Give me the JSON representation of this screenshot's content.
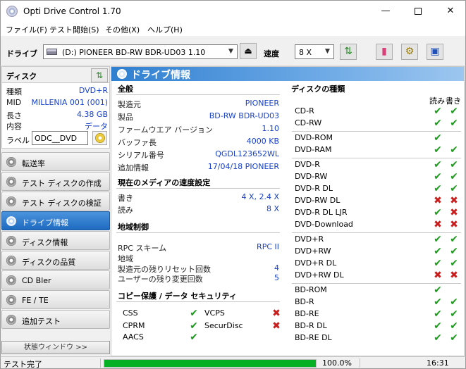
{
  "window": {
    "title": "Opti Drive Control 1.70"
  },
  "menu": [
    "ファイル(F)",
    "テスト開始(S)",
    "その他(X)",
    "ヘルプ(H)"
  ],
  "toolbar": {
    "drive_label": "ドライブ",
    "drive_value": "(D:)   PIONEER BD-RW   BDR-UD03 1.10",
    "speed_label": "速度",
    "speed_value": "8 X"
  },
  "disc": {
    "header": "ディスク",
    "fields": [
      {
        "key": "種類",
        "value": "DVD+R"
      },
      {
        "key": "MID",
        "value": "MILLENIA 001 (001)"
      },
      {
        "key": "長さ",
        "value": "4.38 GB"
      },
      {
        "key": "内容",
        "value": "データ"
      }
    ],
    "label_key": "ラベル",
    "label_value": "ODC__DVD"
  },
  "nav": [
    {
      "label": "転送率",
      "active": false
    },
    {
      "label": "テスト ディスクの作成",
      "active": false
    },
    {
      "label": "テスト ディスクの検証",
      "active": false
    },
    {
      "label": "ドライブ情報",
      "active": true
    },
    {
      "label": "ディスク情報",
      "active": false
    },
    {
      "label": "ディスクの品質",
      "active": false
    },
    {
      "label": "CD Bler",
      "active": false
    },
    {
      "label": "FE / TE",
      "active": false
    },
    {
      "label": "追加テスト",
      "active": false
    }
  ],
  "status_window_label": "状態ウィンドウ >>",
  "main": {
    "title": "ドライブ情報",
    "general": {
      "heading": "全般",
      "rows": [
        {
          "key": "製造元",
          "value": "PIONEER"
        },
        {
          "key": "製品",
          "value": "BD-RW   BDR-UD03"
        },
        {
          "key": "ファームウエア バージョン",
          "value": "1.10"
        },
        {
          "key": "バッファ長",
          "value": "4000 KB"
        },
        {
          "key": "シリアル番号",
          "value": "QGDL123652WL"
        },
        {
          "key": "追加情報",
          "value": "17/04/18  PIONEER"
        }
      ]
    },
    "speed": {
      "heading": "現在のメディアの速度設定",
      "rows": [
        {
          "key": "書き",
          "value": "4 X, 2.4 X"
        },
        {
          "key": "読み",
          "value": "8 X"
        }
      ]
    },
    "region": {
      "heading": "地域制御",
      "rows": [
        {
          "key": "RPC スキーム",
          "value": "RPC II"
        },
        {
          "key": "地域",
          "value": ""
        },
        {
          "key": "製造元の残りリセット回数",
          "value": "4"
        },
        {
          "key": "ユーザーの残り変更回数",
          "value": "5"
        }
      ]
    },
    "copy": {
      "heading": "コピー保護 / データ セキュリティ",
      "items": [
        {
          "name": "CSS",
          "supported": true
        },
        {
          "name": "VCPS",
          "supported": false
        },
        {
          "name": "CPRM",
          "supported": true
        },
        {
          "name": "SecurDisc",
          "supported": false
        },
        {
          "name": "AACS",
          "supported": true
        }
      ]
    },
    "disc_types": {
      "heading": "ディスクの種類",
      "read_label": "読み",
      "write_label": "書き",
      "groups": [
        [
          {
            "name": "CD-R",
            "read": true,
            "write": true
          },
          {
            "name": "CD-RW",
            "read": true,
            "write": true
          }
        ],
        [
          {
            "name": "DVD-ROM",
            "read": true,
            "write": null
          },
          {
            "name": "DVD-RAM",
            "read": true,
            "write": true
          }
        ],
        [
          {
            "name": "DVD-R",
            "read": true,
            "write": true
          },
          {
            "name": "DVD-RW",
            "read": true,
            "write": true
          },
          {
            "name": "DVD-R DL",
            "read": true,
            "write": true
          },
          {
            "name": "DVD-RW DL",
            "read": false,
            "write": false
          },
          {
            "name": "DVD-R DL LJR",
            "read": true,
            "write": false
          },
          {
            "name": "DVD-Download",
            "read": false,
            "write": false
          }
        ],
        [
          {
            "name": "DVD+R",
            "read": true,
            "write": true
          },
          {
            "name": "DVD+RW",
            "read": true,
            "write": true
          },
          {
            "name": "DVD+R DL",
            "read": true,
            "write": true
          },
          {
            "name": "DVD+RW DL",
            "read": false,
            "write": false
          }
        ],
        [
          {
            "name": "BD-ROM",
            "read": true,
            "write": null
          },
          {
            "name": "BD-R",
            "read": true,
            "write": true
          },
          {
            "name": "BD-RE",
            "read": true,
            "write": true
          },
          {
            "name": "BD-R DL",
            "read": true,
            "write": true
          },
          {
            "name": "BD-RE DL",
            "read": true,
            "write": true
          }
        ]
      ]
    }
  },
  "status": {
    "text": "テスト完了",
    "progress": 100,
    "progress_label": "100.0%",
    "time": "16:31"
  }
}
